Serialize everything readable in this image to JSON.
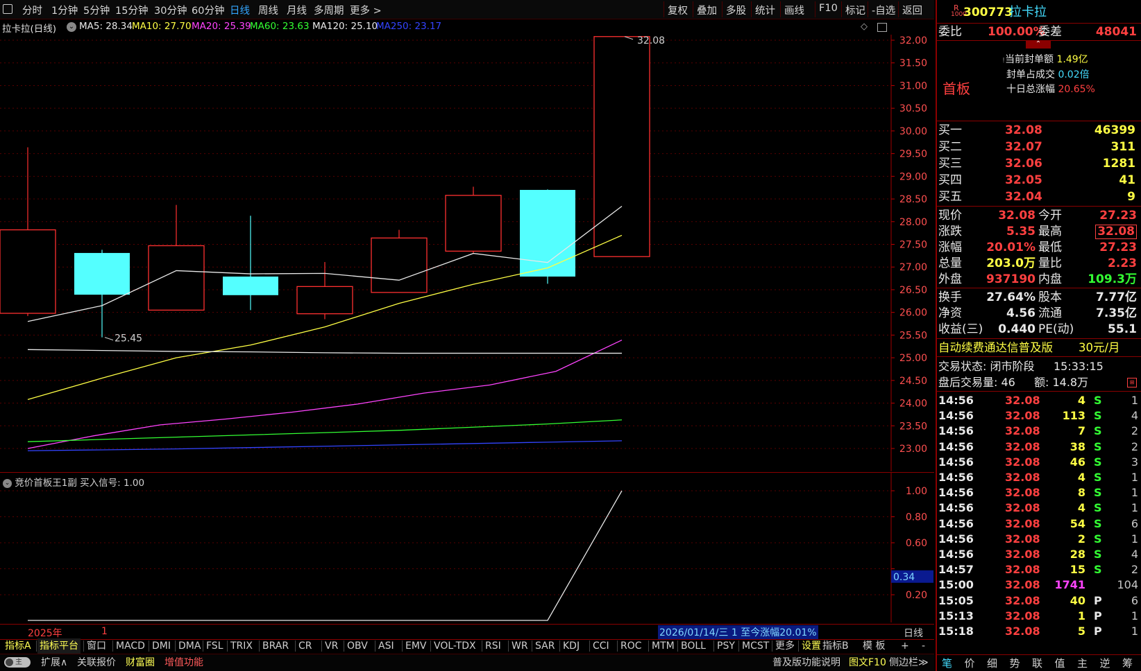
{
  "toolbar": {
    "tabs": [
      "分时",
      "1分钟",
      "5分钟",
      "15分钟",
      "30分钟",
      "60分钟",
      "日线",
      "周线",
      "月线",
      "多周期",
      "更多 >"
    ],
    "active_tab": "日线",
    "right_buttons": [
      "复权",
      "叠加",
      "多股",
      "统计",
      "画线",
      "F10",
      "标记",
      "-自选",
      "返回"
    ]
  },
  "chart_header": {
    "name": "拉卡拉(日线)",
    "ma": [
      {
        "label": "MA5: 28.34",
        "color": "#e8e8e8"
      },
      {
        "label": "MA10: 27.70",
        "color": "#ffff44"
      },
      {
        "label": "MA20: 25.39",
        "color": "#ff44ff"
      },
      {
        "label": "MA60: 23.63",
        "color": "#33ff33"
      },
      {
        "label": "MA120: 25.10",
        "color": "#e8e8e8"
      },
      {
        "label": "MA250: 23.17",
        "color": "#3344ff"
      }
    ]
  },
  "chart_data": [
    {
      "type": "candlestick",
      "title": "",
      "ylim": [
        22.8,
        32.3
      ],
      "y_ticks": [
        "32.00",
        "31.50",
        "31.00",
        "30.50",
        "30.00",
        "29.50",
        "29.00",
        "28.50",
        "28.00",
        "27.50",
        "27.00",
        "26.50",
        "26.00",
        "25.50",
        "25.00",
        "24.50",
        "24.00",
        "23.50",
        "23.00"
      ],
      "candles": [
        {
          "open": 25.98,
          "close": 27.82,
          "high": 29.64,
          "low": 25.92
        },
        {
          "open": 27.31,
          "close": 26.39,
          "high": 27.38,
          "low": 25.45
        },
        {
          "open": 26.05,
          "close": 27.47,
          "high": 28.37,
          "low": 26.05
        },
        {
          "open": 26.79,
          "close": 26.38,
          "high": 28.13,
          "low": 26.05
        },
        {
          "open": 25.97,
          "close": 26.57,
          "high": 27.11,
          "low": 25.85
        },
        {
          "open": 26.44,
          "close": 27.64,
          "high": 27.82,
          "low": 26.44
        },
        {
          "open": 27.35,
          "close": 28.58,
          "high": 28.77,
          "low": 27.3
        },
        {
          "open": 28.7,
          "close": 26.79,
          "high": 28.71,
          "low": 26.63
        },
        {
          "open": 27.23,
          "close": 32.08,
          "high": 32.08,
          "low": 27.23
        }
      ],
      "ma_series": [
        {
          "name": "MA5",
          "color": "#e8e8e8",
          "values": [
            25.8,
            26.15,
            26.92,
            26.85,
            26.86,
            26.71,
            27.3,
            27.1,
            28.34
          ]
        },
        {
          "name": "MA10",
          "color": "#ffff44",
          "values": [
            24.08,
            24.55,
            25.0,
            25.28,
            25.68,
            26.2,
            26.62,
            26.98,
            27.7
          ]
        },
        {
          "name": "MA20",
          "color": "#ff44ff",
          "values": [
            23.0,
            23.28,
            23.52,
            23.65,
            23.8,
            23.98,
            24.22,
            24.4,
            24.7,
            25.39
          ]
        },
        {
          "name": "MA60",
          "color": "#33ff33",
          "values": [
            23.15,
            23.2,
            23.25,
            23.3,
            23.35,
            23.4,
            23.47,
            23.54,
            23.63
          ]
        },
        {
          "name": "MA120",
          "color": "#e8e8e8",
          "values": [
            25.18,
            25.16,
            25.14,
            25.13,
            25.11,
            25.1,
            25.1,
            25.1,
            25.1
          ]
        },
        {
          "name": "MA250",
          "color": "#3344ff",
          "values": [
            22.95,
            22.97,
            22.99,
            23.02,
            23.05,
            23.08,
            23.11,
            23.14,
            23.17
          ]
        }
      ],
      "annotations": [
        {
          "label": "32.08",
          "candle": 8,
          "value": 32.08
        },
        {
          "label": "25.45",
          "candle": 1,
          "value": 25.45
        }
      ]
    },
    {
      "type": "line",
      "title": "竞价首板王1副  买入信号: 1.00",
      "ylim": [
        0.0,
        1.1
      ],
      "y_ticks": [
        "1.00",
        "0.80",
        "0.60",
        "0.40",
        "0.20"
      ],
      "current_value_label": "0.34",
      "values": [
        0,
        0,
        0,
        0,
        0,
        0,
        0,
        0,
        1.0
      ]
    }
  ],
  "bottom_info": {
    "year_label": "2025年",
    "month_label": "1",
    "range_label": "2026/01/14/三 1 至今涨幅20.01%",
    "period": "日线"
  },
  "indicator_tabs": [
    "指标A",
    "指标平台",
    "窗口",
    "MACD",
    "DMI",
    "DMA",
    "FSL",
    "TRIX",
    "BRAR",
    "CR",
    "VR",
    "OBV",
    "ASI",
    "EMV",
    "VOL-TDX",
    "RSI",
    "WR",
    "SAR",
    "KDJ",
    "CCI",
    "ROC",
    "MTM",
    "BOLL",
    "PSY",
    "MCST",
    "更多",
    "设置"
  ],
  "indicator_tabs_right": [
    "指标B",
    "模 板",
    "+",
    "-"
  ],
  "status_bar": {
    "toggle": "主",
    "items": [
      "扩展∧",
      "关联报价",
      "财富圈",
      "增值功能"
    ],
    "right_items": [
      "普及版功能说明",
      "图文F10",
      "侧边栏≫"
    ]
  },
  "stock": {
    "badge": "R",
    "badge_sub": "1000",
    "code": "300773",
    "name": "拉卡拉",
    "weibi_label": "委比",
    "weibi_value": "100.00%",
    "weicha_label": "委差",
    "weicha_value": "48041",
    "board_tag": "首板",
    "seal_amount_label": "当前封单额",
    "seal_amount_value": "1.49亿",
    "seal_ratio_label": "封单占成交",
    "seal_ratio_value": "0.02倍",
    "ten_day_label": "十日总涨幅",
    "ten_day_value": "20.65%"
  },
  "order_book": [
    {
      "label": "买一",
      "price": "32.08",
      "volume": "46399"
    },
    {
      "label": "买二",
      "price": "32.07",
      "volume": "311"
    },
    {
      "label": "买三",
      "price": "32.06",
      "volume": "1281"
    },
    {
      "label": "买四",
      "price": "32.05",
      "volume": "41"
    },
    {
      "label": "买五",
      "price": "32.04",
      "volume": "9"
    }
  ],
  "quote": [
    {
      "l1": "现价",
      "v1": "32.08",
      "c1": "red",
      "l2": "今开",
      "v2": "27.23",
      "c2": "red"
    },
    {
      "l1": "涨跌",
      "v1": "5.35",
      "c1": "red",
      "l2": "最高",
      "v2": "32.08",
      "c2": "red"
    },
    {
      "l1": "涨幅",
      "v1": "20.01%",
      "c1": "red",
      "l2": "最低",
      "v2": "27.23",
      "c2": "red"
    },
    {
      "l1": "总量",
      "v1": "203.0万",
      "c1": "yellow",
      "l2": "量比",
      "v2": "2.23",
      "c2": "red"
    },
    {
      "l1": "外盘",
      "v1": "937190",
      "c1": "red",
      "l2": "内盘",
      "v2": "109.3万",
      "c2": "green"
    }
  ],
  "fundamentals": [
    {
      "l1": "换手",
      "v1": "27.64%",
      "l2": "股本",
      "v2": "7.77亿"
    },
    {
      "l1": "净资",
      "v1": "4.56",
      "l2": "流通",
      "v2": "7.35亿"
    },
    {
      "l1": "收益(三)",
      "v1": "0.440",
      "l2": "PE(动)",
      "v2": "55.1"
    }
  ],
  "promo": {
    "text": "自动续费通达信普及版",
    "price": "30元/月"
  },
  "trade_status": {
    "status_label": "交易状态: 闭市阶段",
    "time": "15:33:15",
    "after_label": "盘后交易量: 46",
    "amount_label": "额: 14.8万"
  },
  "ticks": [
    {
      "time": "14:56",
      "price": "32.08",
      "vol": "4",
      "side": "S",
      "n": "1"
    },
    {
      "time": "14:56",
      "price": "32.08",
      "vol": "113",
      "side": "S",
      "n": "4"
    },
    {
      "time": "14:56",
      "price": "32.08",
      "vol": "7",
      "side": "S",
      "n": "2"
    },
    {
      "time": "14:56",
      "price": "32.08",
      "vol": "38",
      "side": "S",
      "n": "2"
    },
    {
      "time": "14:56",
      "price": "32.08",
      "vol": "46",
      "side": "S",
      "n": "3"
    },
    {
      "time": "14:56",
      "price": "32.08",
      "vol": "4",
      "side": "S",
      "n": "1"
    },
    {
      "time": "14:56",
      "price": "32.08",
      "vol": "8",
      "side": "S",
      "n": "1"
    },
    {
      "time": "14:56",
      "price": "32.08",
      "vol": "4",
      "side": "S",
      "n": "1"
    },
    {
      "time": "14:56",
      "price": "32.08",
      "vol": "54",
      "side": "S",
      "n": "6"
    },
    {
      "time": "14:56",
      "price": "32.08",
      "vol": "2",
      "side": "S",
      "n": "1"
    },
    {
      "time": "14:56",
      "price": "32.08",
      "vol": "28",
      "side": "S",
      "n": "4"
    },
    {
      "time": "14:57",
      "price": "32.08",
      "vol": "15",
      "side": "S",
      "n": "2"
    },
    {
      "time": "15:00",
      "price": "32.08",
      "vol": "1741",
      "side": "",
      "n": "104"
    },
    {
      "time": "15:05",
      "price": "32.08",
      "vol": "40",
      "side": "P",
      "n": "6"
    },
    {
      "time": "15:13",
      "price": "32.08",
      "vol": "1",
      "side": "P",
      "n": "1"
    },
    {
      "time": "15:18",
      "price": "32.08",
      "vol": "5",
      "side": "P",
      "n": "1"
    }
  ],
  "right_tabs": [
    "笔",
    "价",
    "细",
    "势",
    "联",
    "值",
    "主",
    "逆",
    "筹"
  ]
}
